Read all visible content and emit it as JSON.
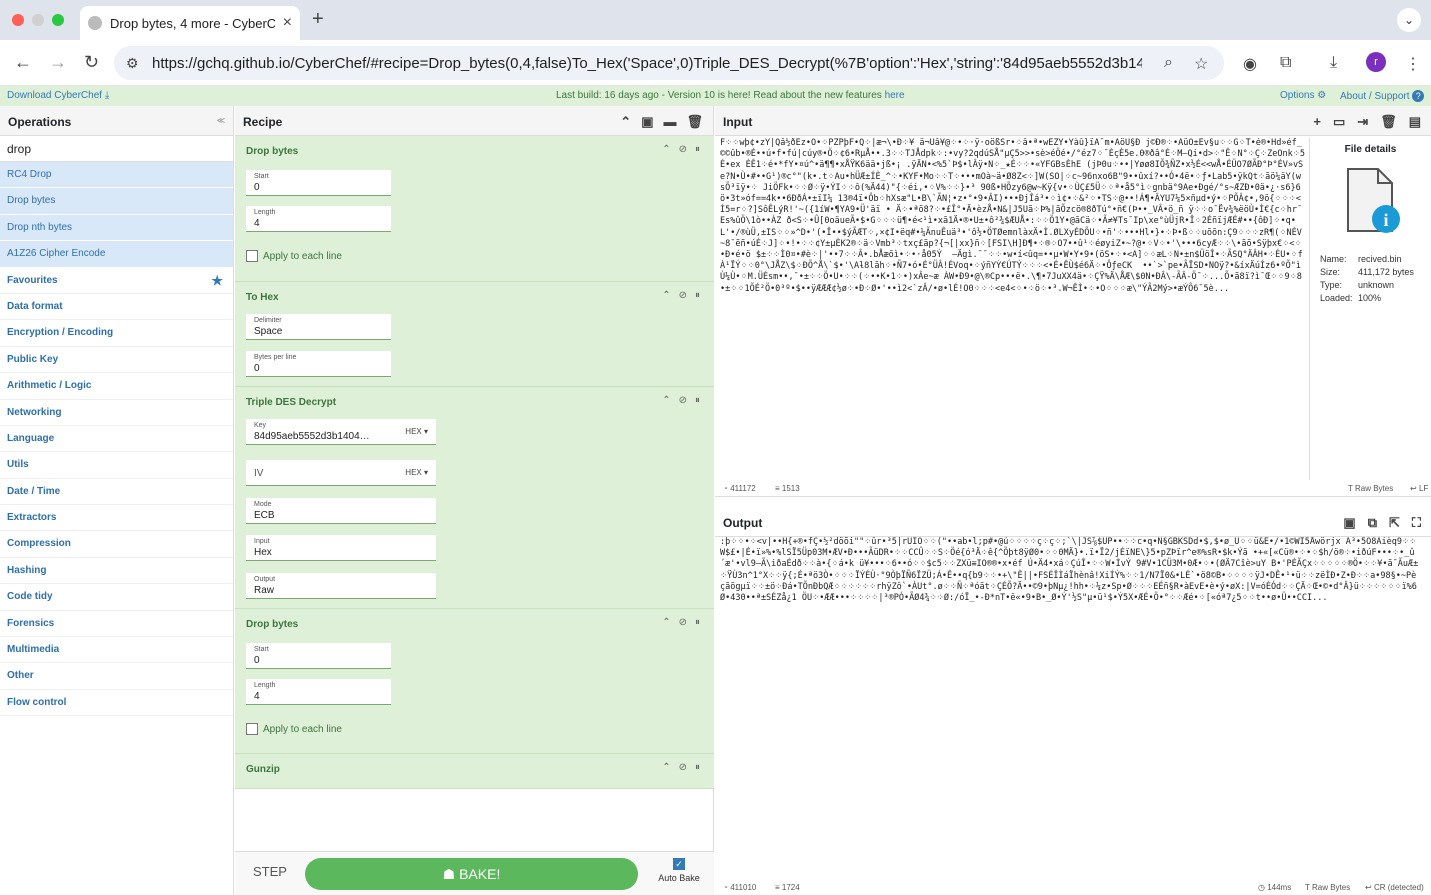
{
  "browser": {
    "tab_title": "Drop bytes, 4 more - CyberCh",
    "url": "https://gchq.github.io/CyberChef/#recipe=Drop_bytes(0,4,false)To_Hex('Space',0)Triple_DES_Decrypt(%7B'option':'Hex','string':'84d95aeb5552d3b140...",
    "avatar_letter": "r"
  },
  "banner": {
    "download": "Download CyberChef",
    "message": "Last build: 16 days ago - Version 10 is here! Read about the new features",
    "message_link": "here",
    "options": "Options",
    "about": "About / Support"
  },
  "operations": {
    "title": "Operations",
    "search": "drop",
    "results": [
      "RC4 Drop",
      "Drop bytes",
      "Drop nth bytes",
      "A1Z26 Cipher Encode"
    ],
    "categories": [
      "Favourites",
      "Data format",
      "Encryption / Encoding",
      "Public Key",
      "Arithmetic / Logic",
      "Networking",
      "Language",
      "Utils",
      "Date / Time",
      "Extractors",
      "Compression",
      "Hashing",
      "Code tidy",
      "Forensics",
      "Multimedia",
      "Other",
      "Flow control"
    ]
  },
  "recipe": {
    "title": "Recipe",
    "op1": {
      "title": "Drop bytes",
      "start_label": "Start",
      "start": "0",
      "length_label": "Length",
      "length": "4",
      "each_line": "Apply to each line"
    },
    "op2": {
      "title": "To Hex",
      "delim_label": "Delimiter",
      "delim": "Space",
      "bpl_label": "Bytes per line",
      "bpl": "0"
    },
    "op3": {
      "title": "Triple DES Decrypt",
      "key_label": "Key",
      "key": "84d95aeb5552d3b1404…",
      "key_fmt": "HEX",
      "iv_label": "IV",
      "iv_fmt": "HEX",
      "mode_label": "Mode",
      "mode": "ECB",
      "input_label": "Input",
      "input": "Hex",
      "output_label": "Output",
      "output": "Raw"
    },
    "op4": {
      "title": "Drop bytes",
      "start_label": "Start",
      "start": "0",
      "length_label": "Length",
      "length": "4",
      "each_line": "Apply to each line"
    },
    "op5": {
      "title": "Gunzip"
    },
    "step": "STEP",
    "bake": "BAKE!",
    "autobake": "Auto Bake"
  },
  "input": {
    "title": "Input",
    "text": "F⁘⁘wþ¢•zY|Qâ½ðÉz•Ö•⁘PZPþF•Q⁘|æ¬\\•Ð⁘¥ ä¬Ûâ¥@⁘•⁘·ÿ·oößSr•⁘â•ª•wÊZÝ•Yàû}ïÄ¯m•ÄöÙ§Ð j©Ð®⁘•ÃüÖ±Êv§u⁘⁘G⁘T•é®•Hd»éf_©©ûb•®É••ú•f•fú|cúy®•Ö⁘¢6•RµÅ••.3⁘⁘TJÅdpk⁘:•vy?2qdúSÅ\"µÇ5>>•sè>éÖé•/°éz7⁘¯ÈçÈ5e.0®ðâ°É⁘M—Qi•d>⁘\"Ê⁘N°⁘Ç⁘ZeOnk⁘5É•ex ÉÊ1⁘é•*fY•¤ú^•ä¶¶•xÅŸK6ää•jß•¡ .ÿÄN•<%5`Þ$•lÂÿ•N⁘_★É⁘⁘•«YFGBsÈhE (jÞ0u⁘••|Yøø8IÕ¾ÑZ•x½É<<wÅ•ÉÜO7ØÃÐ°Þ°ÉV»vSe?N•Ù•#••G¹)®c°\"(k•.t⁘Au•hÜÆ±ÍÈ_^⁘•KYF•Mo⁘⁘T⁘•••mOà~ä•Ø8Z<⁘]W(SO|⁘c~96nxo6B\"9••ûxí?••Ó•4ë•⁘ƒ•Lab5•ÿkQt⁘ãö¼äY(w  sÕ³ïÿ•⁘ JiÖFk•⁘⁘Ø⁘ÿ•ÝI⁘⁘ô(%Ä44)\"{⁘éi,•⁘V%⁘⁘}•³ 90ß•HÕzy6@w~Kÿ{v•⁘ÙÇ£5Ü⁘⁘ª•å5°ì⁘gnbä°9Ae•Ðgé/°s~ÆZÐ•0ä•¿·s6}6ö•3t»óf==4k••6ÐðÁ•±ïI¼ 13®4ï•Ôb⁘hXsæ\"L•B\\`ÃN¦•z•°•9•ÂI)•••ÐjÎá³•⁘ì¢•⁘&²⁘•TS⁘@••!Á¶•ÂYU7¼5×ñµd•ý•⁘PÕÂ¢•,9ö{⁘⁘⁘<Í5=r⁘?]SôÊLýR!'~({1íW•¶YA9•Ü'äï • Ä⁘•ªõ8?⁘•£Î°•Ä•èzÅ•N&|J5Uã⁘Þ%|ãÕzcö®8ðTú°•ñ€(Þ••_VÂ•ö_ñ ÿ⁘⁘o¯Ëv¾%ëöÙ•Ì€{c⁘hr¯Es%ûÖ\\1ò••ÁZ ð<S⁘•Û[0oäueÃ•$•G⁘⁘⁘ü¶•é<¹ì•xã1Ä•®•U±•ô²¾$ÆUÅ•:⁘⁘Ö1Y•@ãCä⁘•Ã≠¥Ts¯Ip\\xe°ùÜjR•Î⁘2ÉñïjÆÉ#••{ôÐ]⁘•q•L'•/®ùÜ,±IS⁘⁘»^D•'(•Î••$ýÃÆT⁘,×¢I•ëq#•¼ÃnuÊuä³•'ô½•ÖTØemnlàxÄ•Ì.ØLXyÉDÕU⁘•ñ'⁘•••Hl•}•⁘Þ•ß⁘⁘uõõn:Ç9⁘⁘⁘zR¶(⁘NÉV~8¯ẽñ•úÉ⁘J]⁘•!•⁘⁘¢Y±µÈK2®⁘ä⁘Vmb³⁘txç£ãp?{¬[|xx}ñ⁘[FSI\\H]Ð¶•⁘®⁘O7••û¹⁘éøyiZ•~?@•⁘V⁘•'\\•••6cyÆ⁘⁘\\•ãõ•Sÿþx€⁘<⁘•Ð•é•ö $±⁘⁘Ì0¤•#è⁘|'••7⁘⁘Â•.bÅæõì•⁘•·å05Ý  —Ägì.¯¯⁘⁘•w•í<ûq=••µ•W•Y•9•(öS•⁘•<A]⁘⁘æL⁘N•±n$ÜöÎ•⁘ÃSQ°ÄÂH•⁘ÉU•⁘fÀ¹ÏÝ⁘⁘0°\\JÅZ\\$⁘ÐÕ^Å\\`$•'\\Aƚ8lãh⁘•Ñ7•ó•É°ÜÂ!ÉVoq•⁘ýñYÝ€ÚTÝ⁘⁘⁘<•É•ÊÙ$é6Ä⁘•ÔƒeCK  ••`>`pe•ÃÏSD•NOÿ?•&íxÄúÍz6•ºÕ\"ìÙ¼Ù•⁘M.ÜÉsm••,¯•±⁘⁘Ö•U•⁘⁘(⁘••K•1⁘•)xÂe~æ ÀW•Ð9•@\\®Cp•••ë•.\\¶•7JuXX4ä•⁘ÇŸ%Ä\\ÅÆ\\$0N•ÐÂ\\-ÃÂ-Ö¯⁘...Õ•ã8ï?ì¯Œ⁘⁘9⁘8•±⁘⁘1ÕÉ²Ö•0³º•$••ÿÆÆÆ¢½ø⁘•Ð⁘Ø•'••ì2<`zÂ/•ø•lÉ!O0⁘⁘⁘<e4<⁘•⁘ö⁘•³.W¬ÊÌ•⁘•O⁘⁘⁘æ\\\"ÝÃ2Mý>•æÝÔ6¯5è..."
  },
  "file": {
    "title": "File details",
    "name_k": "Name:",
    "name": "recived.bin",
    "size_k": "Size:",
    "size": "411,172 bytes",
    "type_k": "Type:",
    "type": "unknown",
    "loaded_k": "Loaded:",
    "loaded": "100%"
  },
  "input_status": {
    "length": "411172",
    "lines": "1513",
    "enc": "Raw Bytes",
    "eol": "LF"
  },
  "output": {
    "title": "Output",
    "text": ":þ⁘⁘•⁘<v|••H{+®•fÇ•½²döõi\"\"⁘ûr•³5|rÜÏO⁘⁘(\"••ab•l;p#•@ú⁘⁘⁘⁘ç⁘ç⁘;`\\|JS⅞$ÜP••⁘⁘c•q•Ñ§GBKSDd•$,$•ø_Ù⁘⁘ü&É•/•1©WÏ5Åwörjx Á³•5Ö8Äièq9⁘⁘W$£•|É•ï»%•%lSÏ5Üp03M•ÆV•Ð•••ÃüDR•⁘⁘CCÛ⁘⁘S⁘Öé{ó³Ä⁘ê{^Öþt8ÿØ0•⁘⁘0MÄ}•.ï•Ï2/jÉïNE\\}5•pZÞïr^e®%sR•$k•Ýã •+«[«Cü®•⁘•⁘$h/ö®⁘•iðúF•••⁘•_û´æ'•vl9–Ã\\iðaÉdð⁘⁘à•{⁘á•k ü¥•••⁘6••ó⁘⁘$c5⁘⁘ZXü≡IO®®•x•éf Ú•Ä4•xá⁘ÇúÎ•⁘⁘W•ÌvÝ 9#V•1CÜ3M•0Æ•⁘•(ØÄ7Cîè>uY B•'PÉÃÇx⁘⁘⁘⁘⁘®Ö•⁘⁘¥•ã¯ÃuÆ± ⁘ŸÙ3n^1°X⁘⁘ÿ{;É•ªö3Ò•⁘⁘⁘ÏÝÉÙ·°9ÒþÏÑ6ÏZÜ;Á•Ê••q{b9⁘⁘•+\\\"Ê||•FSÉÎÌáÏhènâ!XiÍÝ%⁘⁘1/N7Ï0&•LÉ`•ö8©B•⁘⁘⁘⁘ÿJ•DÊ•¹•ü⁘⁘zëÌÐ•Z•Ð⁘⁘a•98§•~Pèçãõgµï⁘⁘±ö⁘Ðá•TÕnÐbQÆ⁘⁘⁘⁘⁘⁘rhÿZô`•ÀUt°.ø⁘⁘Ñ⁘ªóãt⁘ÇÉÕ?Ä••©9•þNµ¿!hh•⁘¼z•Sp•Ø⁘⁘⁘EÉñ§R•àEvE•è•ý•øX:|V=óÈÓd⁘⁘ÇÄ⁘Œ•©•d°Â}ü⁘⁘⁘⁘⁘⁘ï%6Ø•430••ª±SÉZå¿1 ÖU⁘•ÆÆ•••⁘⁘⁘⁘|³®PÓ•ÃØ4¾⁘⁘Ø:/óÏ_•-Ð*nT•ë«•9•B•_Ø•Ý'½S\"µ•ü¹$•Ý5X•ÆÉ•Ö•°⁘⁘Æé•⁘[«óª7¿5⁘⁘t••ø•Ü••CCI...",
    "status_len": "411010",
    "status_lines": "1724",
    "time": "144ms",
    "enc": "Raw Bytes",
    "eol": "CR (detected)"
  }
}
